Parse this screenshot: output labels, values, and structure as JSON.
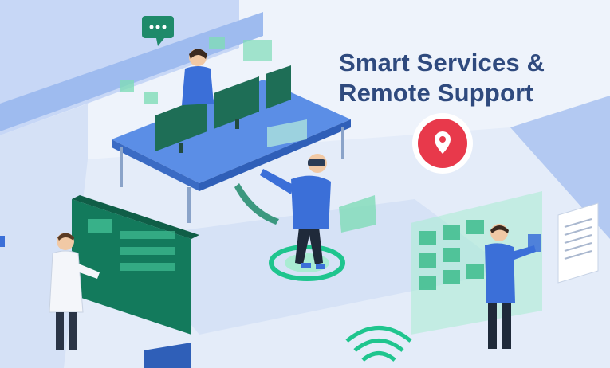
{
  "headline": {
    "line1": "Smart Services &",
    "line2": "Remote Support"
  },
  "icons": {
    "location_pin": "location-pin-icon",
    "chat_bubble": "chat-bubble-icon",
    "wifi": "wifi-signal-icon",
    "document": "document-icon"
  },
  "colors": {
    "title": "#2f4a7e",
    "accent_blue": "#3b6fd8",
    "wall_blue": "#b9cdf3",
    "floor": "#dfe8f7",
    "screen_green": "#1f8a6a",
    "holo_green": "#7fdcb8",
    "pin_red": "#e8394b"
  }
}
